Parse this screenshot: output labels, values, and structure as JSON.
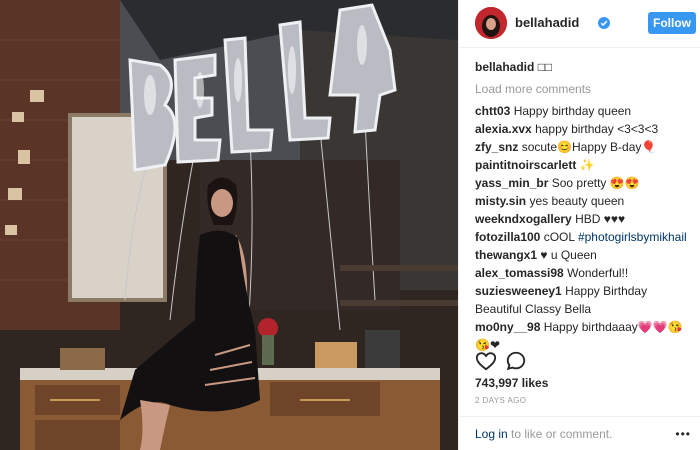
{
  "post": {
    "username": "bellahadid",
    "follow_label": "Follow",
    "caption_user": "bellahadid",
    "caption_text": "□□",
    "load_more": "Load more comments",
    "comments": [
      {
        "user": "chtt03",
        "text": "Happy birthday queen"
      },
      {
        "user": "alexia.xvx",
        "text": "happy birthday <3<3<3"
      },
      {
        "user": "zfy_snz",
        "text": "socute😊Happy B-day🎈"
      },
      {
        "user": "paintitnoirscarlett",
        "text": "✨"
      },
      {
        "user": "yass_min_br",
        "text": "Soo pretty 😍😍"
      },
      {
        "user": "misty.sin",
        "text": "yes beauty queen"
      },
      {
        "user": "weekndxogallery",
        "text": "HBD ♥♥♥"
      },
      {
        "user": "fotozilla100",
        "text": "cOOL ",
        "tag": "#photogirlsbymikhail"
      },
      {
        "user": "thewangx1",
        "text": "♥ u Queen"
      },
      {
        "user": "alex_tomassi98",
        "text": "Wonderful!!"
      },
      {
        "user": "suziesweeney1",
        "text": "Happy Birthday Beautiful Classy Bella"
      },
      {
        "user": "mo0ny__98",
        "text": "Happy birthdaaay💗💗😘😘❤"
      }
    ],
    "likes": "743,997 likes",
    "date": "2 DAYS AGO",
    "footer_login": "Log in",
    "footer_rest": " to like or comment.",
    "more_label": "•••",
    "icons": {
      "like": "heart-icon",
      "comment": "comment-icon",
      "verified": "verified-badge-icon",
      "more": "more-options-icon"
    },
    "colors": {
      "accent": "#3897f0",
      "link": "#003569",
      "muted": "#999999"
    }
  }
}
